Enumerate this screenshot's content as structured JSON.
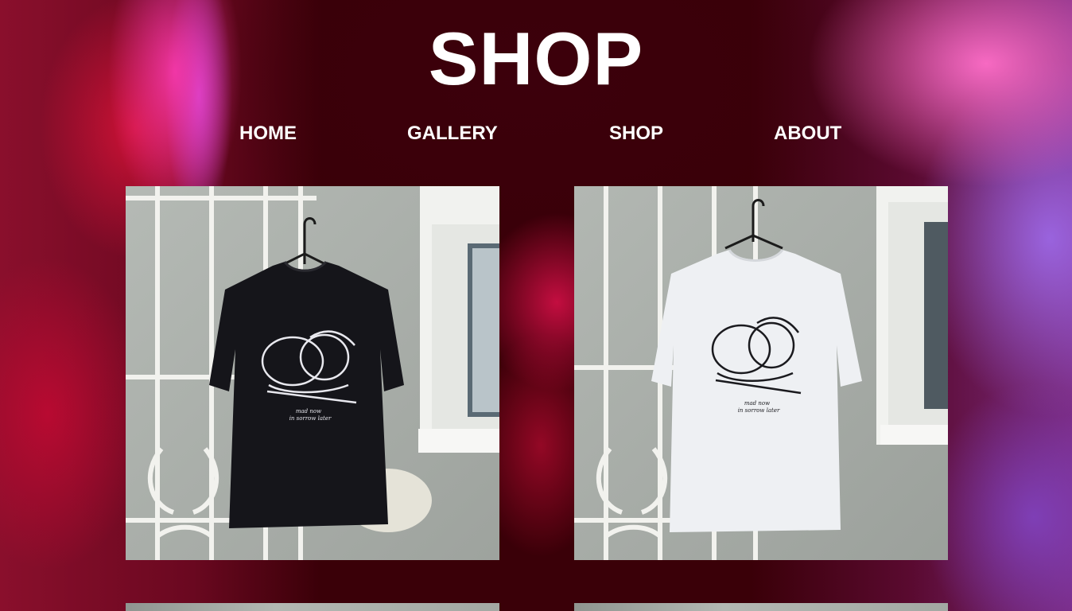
{
  "header": {
    "title": "SHOP"
  },
  "nav": {
    "items": [
      {
        "label": "HOME"
      },
      {
        "label": "GALLERY"
      },
      {
        "label": "SHOP"
      },
      {
        "label": "ABOUT"
      }
    ]
  },
  "products": [
    {
      "shirt_color": "#15151a",
      "print_color": "#e8e8ee",
      "print_text": [
        "mad now",
        "in sorrow later"
      ]
    },
    {
      "shirt_color": "#eef0f3",
      "print_color": "#1a1a1e",
      "print_text": [
        "mad now",
        "in sorrow later"
      ]
    }
  ],
  "colors": {
    "text": "#ffffff",
    "background_dark": "#3a0008",
    "accent_pink": "#ff6ec8",
    "accent_red": "#d20f46"
  }
}
